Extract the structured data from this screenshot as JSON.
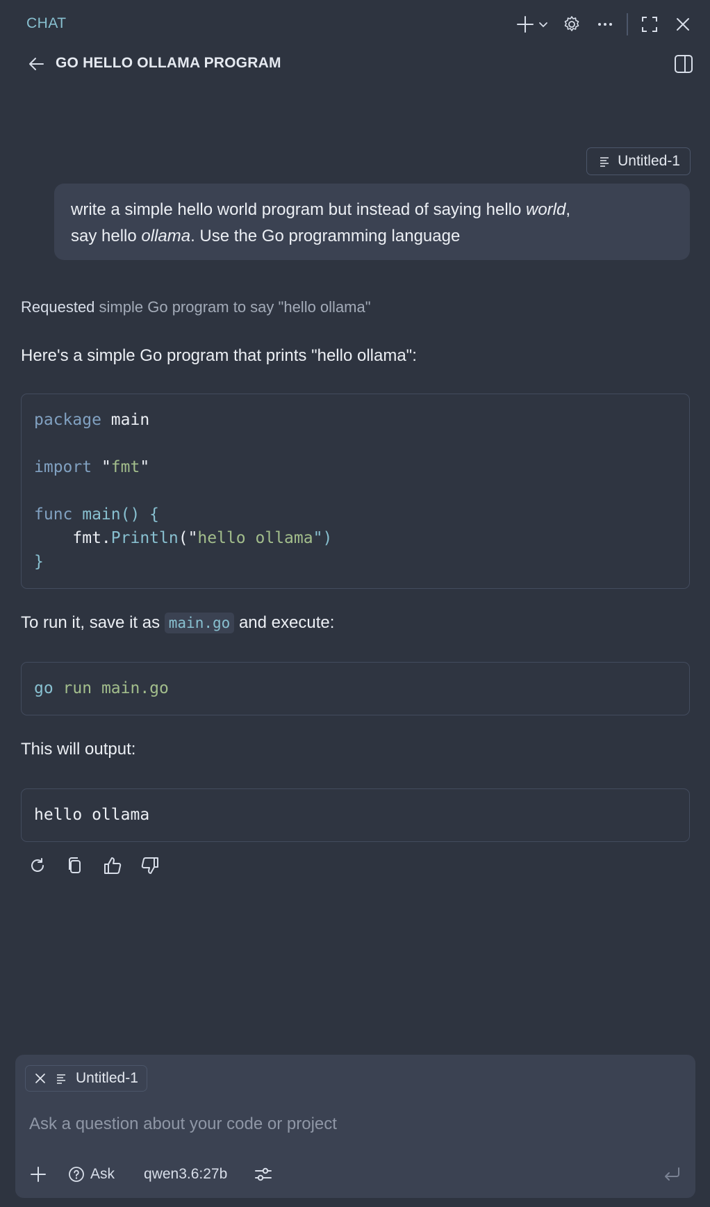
{
  "header": {
    "section_label": "CHAT"
  },
  "conversation": {
    "title": "GO HELLO OLLAMA PROGRAM"
  },
  "user_message": {
    "context_chip": "Untitled-1",
    "segments": [
      {
        "text": "write a simple hello world program but instead of saying hello ",
        "italic": false
      },
      {
        "text": "world",
        "italic": true
      },
      {
        "text": ",\nsay hello ",
        "italic": false
      },
      {
        "text": "ollama",
        "italic": true
      },
      {
        "text": ". Use the Go programming language",
        "italic": false
      }
    ]
  },
  "assistant": {
    "requested_label": "Requested",
    "requested_detail": "simple Go program to say \"hello ollama\"",
    "intro": "Here's a simple Go program that prints \"hello ollama\":",
    "code_main": [
      [
        {
          "t": "package",
          "c": "kw"
        },
        {
          "t": " main",
          "c": ""
        }
      ],
      [],
      [
        {
          "t": "import",
          "c": "kw"
        },
        {
          "t": " \"",
          "c": ""
        },
        {
          "t": "fmt",
          "c": "str"
        },
        {
          "t": "\"",
          "c": ""
        }
      ],
      [],
      [
        {
          "t": "func",
          "c": "kw"
        },
        {
          "t": " main",
          "c": "fn"
        },
        {
          "t": "() {",
          "c": "fn"
        }
      ],
      [
        {
          "t": "    fmt.",
          "c": ""
        },
        {
          "t": "Println",
          "c": "fn"
        },
        {
          "t": "(\"",
          "c": ""
        },
        {
          "t": "hello ollama",
          "c": "str"
        },
        {
          "t": "\")",
          "c": "fn"
        }
      ],
      [
        {
          "t": "}",
          "c": "fn"
        }
      ]
    ],
    "run_text_before": "To run it, save it as ",
    "run_filename": "main.go",
    "run_text_after": " and execute:",
    "code_run": [
      [
        {
          "t": "go",
          "c": "fn"
        },
        {
          "t": " run main.go",
          "c": "str"
        }
      ]
    ],
    "output_label": "This will output:",
    "code_output": [
      [
        {
          "t": "hello ollama",
          "c": ""
        }
      ]
    ]
  },
  "composer": {
    "attachment": "Untitled-1",
    "placeholder": "Ask a question about your code or project",
    "mode": "Ask",
    "model": "qwen3.6:27b"
  },
  "icons": {
    "new_chat": "plus-icon",
    "settings": "gear-icon",
    "more": "ellipsis-icon",
    "maximize": "maximize-icon",
    "close": "close-icon",
    "back": "arrow-left-icon",
    "toggle_panel": "sidebar-toggle-icon",
    "retry": "refresh-icon",
    "copy": "copy-icon",
    "like": "thumbs-up-icon",
    "dislike": "thumbs-down-icon",
    "send": "enter-icon"
  },
  "colors": {
    "background": "#2e3440",
    "surface": "#3b4252",
    "accent": "#88c0d0",
    "keyword": "#81a1c1",
    "string": "#a3be8c"
  }
}
